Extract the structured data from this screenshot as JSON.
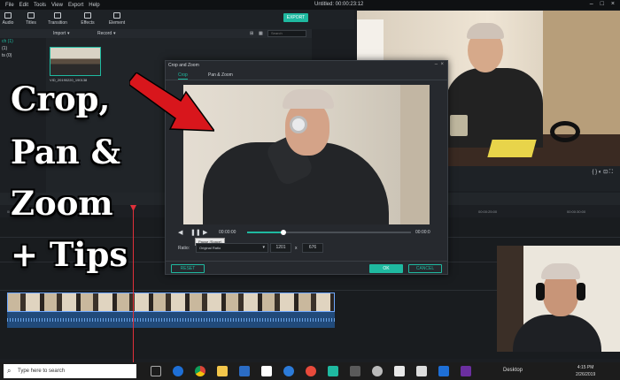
{
  "menubar": {
    "items": [
      "File",
      "Edit",
      "Tools",
      "View",
      "Export",
      "Help"
    ],
    "title": "Untitled: 00:00:23:12"
  },
  "toolbar": {
    "items": [
      {
        "label": "Audio",
        "icon": "music-icon"
      },
      {
        "label": "Titles",
        "icon": "text-icon"
      },
      {
        "label": "Transition",
        "icon": "transition-icon"
      },
      {
        "label": "Effects",
        "icon": "effects-icon"
      },
      {
        "label": "Element",
        "icon": "element-icon"
      }
    ],
    "export_label": "EXPORT"
  },
  "mediabar": {
    "import_label": "Import",
    "record_label": "Record",
    "search_placeholder": "Search"
  },
  "leftnav": {
    "items": [
      "ch (1)",
      "(1)",
      "ts (0)"
    ]
  },
  "media": {
    "clip_label": "VID_20190220_190138"
  },
  "dialog": {
    "title": "Crop and Zoom",
    "tabs": [
      "Crop",
      "Pan & Zoom"
    ],
    "timecode_start": "00:00:00",
    "timecode_end": "00:00:0",
    "progress": 0.22,
    "tooltip": "Pause (Space)",
    "ratio_label": "Ratio:",
    "ratio_value": "Original Ratio",
    "width": "1201",
    "height": "676",
    "separator": "x",
    "reset_label": "RESET",
    "ok_label": "OK",
    "cancel_label": "CANCEL"
  },
  "headline": {
    "lines": [
      "Crop,",
      "Pan &",
      "Zoom",
      "+ Tips"
    ]
  },
  "timeline": {
    "ruler_labels": [
      "00:00:00:00",
      "00:00:25:00",
      "00:00:30:00"
    ]
  },
  "taskbar": {
    "search_placeholder": "Type here to search",
    "desktop_label": "Desktop",
    "time": "4:15 PM",
    "date": "2/26/2019"
  },
  "colors": {
    "accent": "#1fb9a0",
    "playhead": "#e0303a",
    "arrow": "#d8161c"
  }
}
